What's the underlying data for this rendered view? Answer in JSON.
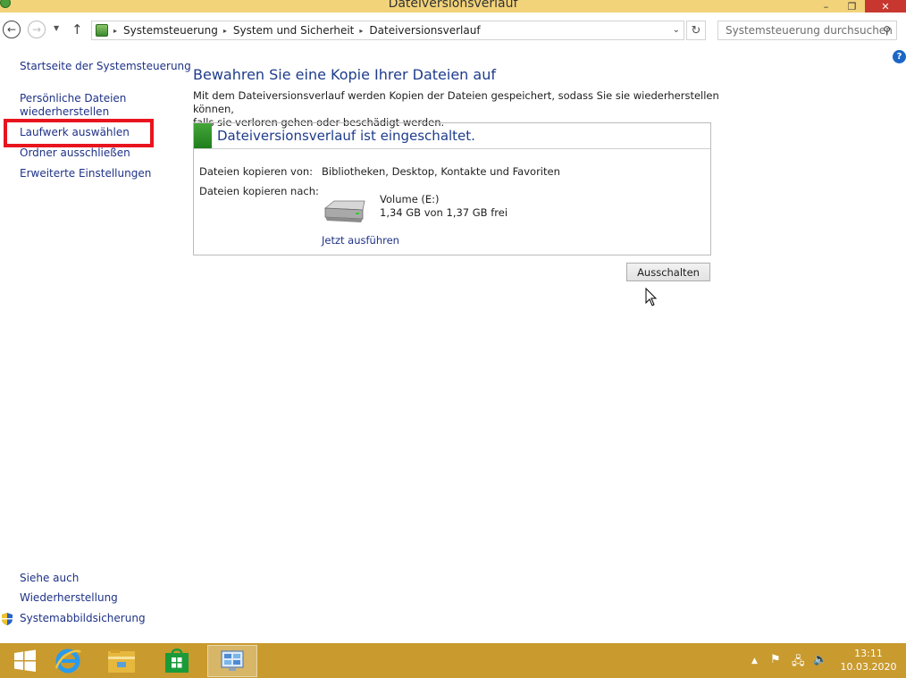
{
  "window": {
    "title": "Dateiversionsverlauf",
    "controls": {
      "minimize": "–",
      "maximize": "❐",
      "close": "✕"
    }
  },
  "nav": {
    "back": "←",
    "forward": "→",
    "recent": "▼",
    "up": "↑",
    "breadcrumbs": [
      "Systemsteuerung",
      "System und Sicherheit",
      "Dateiversionsverlauf"
    ],
    "crumb_sep": "▸",
    "dropdown": "⌄",
    "refresh": "↻",
    "search_placeholder": "Systemsteuerung durchsuchen",
    "search_icon": "⚲"
  },
  "help_label": "?",
  "sidebar": {
    "items": [
      {
        "label": "Startseite der Systemsteuerung"
      },
      {
        "label": "Persönliche Dateien"
      },
      {
        "label": "wiederherstellen"
      },
      {
        "label": "Laufwerk auswählen"
      },
      {
        "label": "Ordner ausschließen"
      },
      {
        "label": "Erweiterte Einstellungen"
      }
    ],
    "see_also": "Siehe auch",
    "see_also_items": [
      {
        "label": "Wiederherstellung"
      },
      {
        "label": "Systemabbildsicherung"
      }
    ],
    "highlight_color": "#e8141d"
  },
  "main": {
    "heading": "Bewahren Sie eine Kopie Ihrer Dateien auf",
    "description_line1": "Mit dem Dateiversionsverlauf werden Kopien der Dateien gespeichert, sodass Sie sie wiederherstellen können,",
    "description_line2": "falls sie verloren gehen oder beschädigt werden.",
    "status": "Dateiversionsverlauf ist eingeschaltet.",
    "copy_from_label": "Dateien kopieren von:",
    "copy_from_value": "Bibliotheken, Desktop, Kontakte und Favoriten",
    "copy_to_label": "Dateien kopieren nach:",
    "drive_name": "Volume (E:)",
    "drive_free": "1,34 GB von 1,37 GB frei",
    "run_now": "Jetzt ausführen",
    "turn_off_button": "Ausschalten"
  },
  "taskbar": {
    "tray": {
      "chevron": "▲",
      "flag": "⚑",
      "network": "🖧",
      "volume": "🔈"
    },
    "time": "13:11",
    "date": "10.03.2020",
    "color": "#c99a2e"
  }
}
